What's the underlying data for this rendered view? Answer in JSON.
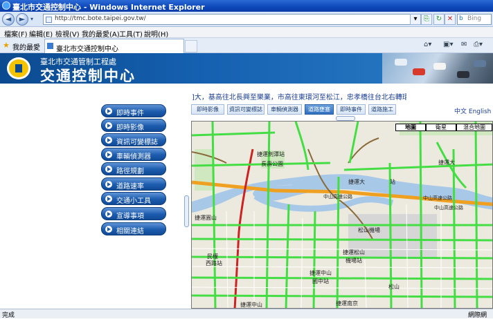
{
  "window": {
    "title": "臺北市交通控制中心 - Windows Internet Explorer"
  },
  "address": {
    "url": "http://tmc.bote.taipei.gov.tw/",
    "search_placeholder": "Bing"
  },
  "menu": [
    "檔案(F)",
    "編輯(E)",
    "檢視(V)",
    "我的最愛(A)",
    "工具(T)",
    "說明(H)"
  ],
  "favorites": {
    "label": "我的最愛",
    "tab_title": "臺北市交通控制中心"
  },
  "banner": {
    "subtitle": "臺北市交通管制工程處",
    "title": "交通控制中心"
  },
  "ticker": "]大，基高往北長興至樂業，市高往東環河至松江，忠孝橋往台北右轉環快。",
  "sidebar": [
    "即時事件",
    "即時影像",
    "資訊可變標誌",
    "車輛偵測器",
    "路徑規劃",
    "道路速率",
    "交通小工具",
    "宣導事項",
    "相關連結"
  ],
  "tabs": [
    {
      "label": "即時影像",
      "active": false
    },
    {
      "label": "資訊可變標誌",
      "active": false
    },
    {
      "label": "車輛偵測器",
      "active": false
    },
    {
      "label": "道路壅塞",
      "active": true
    },
    {
      "label": "即時事件",
      "active": false
    },
    {
      "label": "道路施工",
      "active": false
    }
  ],
  "languages": {
    "zh": "中文",
    "en": "English"
  },
  "map": {
    "buttons": [
      "地圖",
      "衛星",
      "混合地圖"
    ],
    "labels": [
      "捷運劍潭站",
      "長壽公園",
      "捷運大",
      "捷運大",
      "站",
      "松山機場",
      "捷運中山",
      "國中站",
      "捷運松山",
      "機場站",
      "捷運圓山",
      "民權",
      "西路站",
      "捷運中山",
      "捷運南京",
      "松山",
      "中山高速公路",
      "中山高速公路",
      "中山高速公路"
    ]
  },
  "status": {
    "left": "完成",
    "right": "網際網"
  },
  "colors": {
    "road_green": "#44dd44",
    "road_red": "#cc2222",
    "river": "#a8c8e8",
    "highway": "#f0a020"
  }
}
